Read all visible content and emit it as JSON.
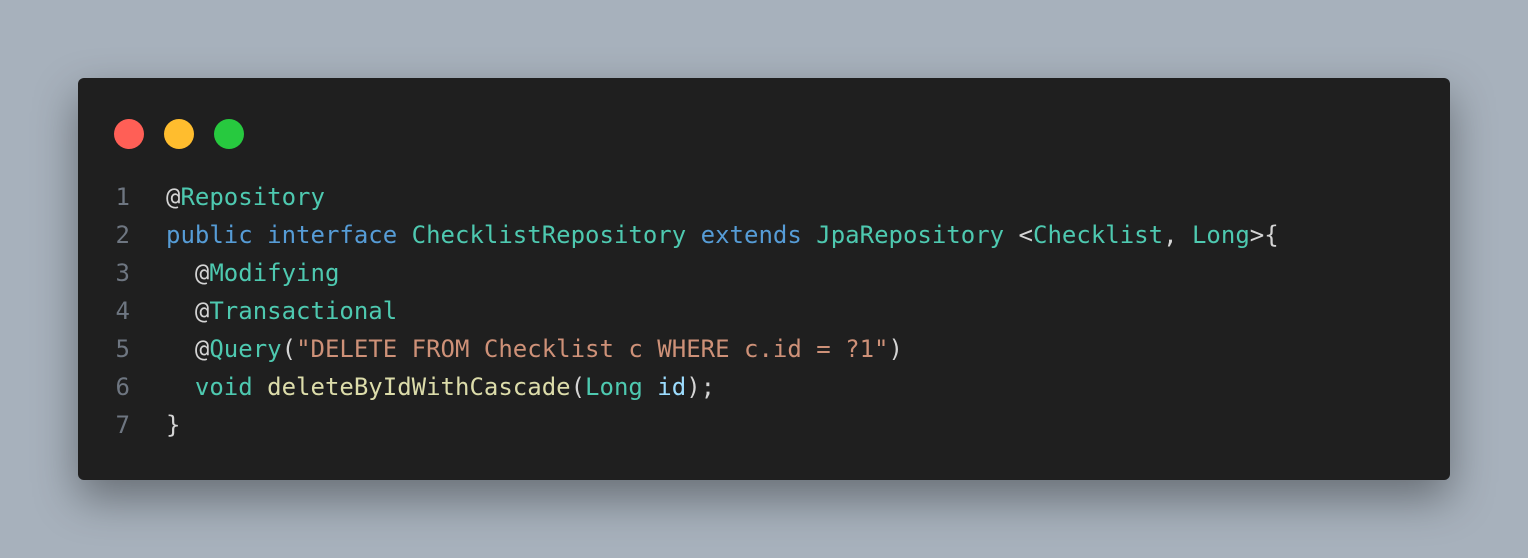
{
  "window": {
    "controls": [
      {
        "name": "close",
        "color": "#ff5f56"
      },
      {
        "name": "minimize",
        "color": "#ffbd2e"
      },
      {
        "name": "maximize",
        "color": "#27c93f"
      }
    ]
  },
  "code": {
    "lines": [
      {
        "n": "1",
        "tokens": [
          {
            "t": "@",
            "k": "plain"
          },
          {
            "t": "Repository",
            "k": "type"
          }
        ]
      },
      {
        "n": "2",
        "tokens": [
          {
            "t": "public",
            "k": "kw"
          },
          {
            "t": " ",
            "k": "plain"
          },
          {
            "t": "interface",
            "k": "kw"
          },
          {
            "t": " ",
            "k": "plain"
          },
          {
            "t": "ChecklistRepository",
            "k": "type"
          },
          {
            "t": " ",
            "k": "plain"
          },
          {
            "t": "extends",
            "k": "kw"
          },
          {
            "t": " ",
            "k": "plain"
          },
          {
            "t": "JpaRepository",
            "k": "type"
          },
          {
            "t": " <",
            "k": "plain"
          },
          {
            "t": "Checklist",
            "k": "type"
          },
          {
            "t": ", ",
            "k": "plain"
          },
          {
            "t": "Long",
            "k": "type"
          },
          {
            "t": ">{",
            "k": "plain"
          }
        ]
      },
      {
        "n": "3",
        "tokens": [
          {
            "t": "  @",
            "k": "plain"
          },
          {
            "t": "Modifying",
            "k": "type"
          }
        ]
      },
      {
        "n": "4",
        "tokens": [
          {
            "t": "  @",
            "k": "plain"
          },
          {
            "t": "Transactional",
            "k": "type"
          }
        ]
      },
      {
        "n": "5",
        "tokens": [
          {
            "t": "  @",
            "k": "plain"
          },
          {
            "t": "Query",
            "k": "type"
          },
          {
            "t": "(",
            "k": "plain"
          },
          {
            "t": "\"DELETE FROM Checklist c WHERE c.id = ?1\"",
            "k": "str"
          },
          {
            "t": ")",
            "k": "plain"
          }
        ]
      },
      {
        "n": "6",
        "tokens": [
          {
            "t": "  ",
            "k": "plain"
          },
          {
            "t": "void",
            "k": "type"
          },
          {
            "t": " ",
            "k": "plain"
          },
          {
            "t": "deleteByIdWithCascade",
            "k": "fn"
          },
          {
            "t": "(",
            "k": "plain"
          },
          {
            "t": "Long",
            "k": "type"
          },
          {
            "t": " ",
            "k": "plain"
          },
          {
            "t": "id",
            "k": "var"
          },
          {
            "t": ");",
            "k": "plain"
          }
        ]
      },
      {
        "n": "7",
        "tokens": [
          {
            "t": "}",
            "k": "plain"
          }
        ]
      }
    ]
  }
}
